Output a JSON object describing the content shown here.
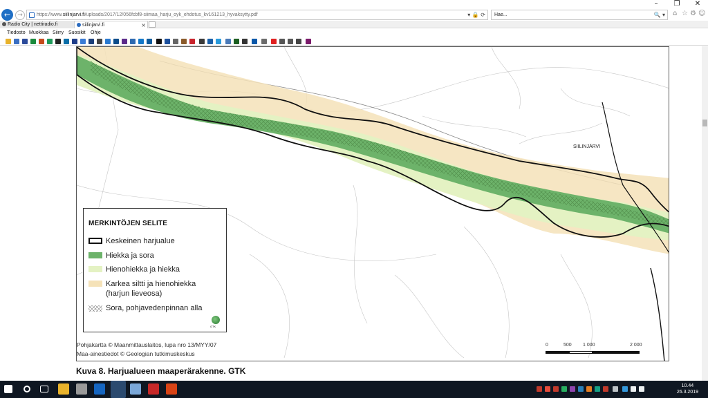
{
  "browser": {
    "window_controls": {
      "minimize": "–",
      "restore": "❐",
      "close": "✕"
    },
    "address": {
      "url_prefix": "https://www.",
      "url_domain": "siilinjarvi.fi",
      "url_path": "/uploads/2017/12/056fcbf8-siimaa_harju_oyk_ehdotus_kv161213_hyvaksytty.pdf",
      "tools": "▾ 🔒 ⟳",
      "search_placeholder": "Hae...",
      "search_tools": "🔍 ▾"
    },
    "tabs": [
      {
        "label": "Radio City | nettiradio.fi",
        "icon_color": "#555555"
      },
      {
        "label": "siilinjarvi.fi",
        "icon_color": "#2a6bbf",
        "close": "×"
      }
    ],
    "menu": [
      "Tiedosto",
      "Muokkaa",
      "Siirry",
      "Suosikit",
      "Ohje"
    ]
  },
  "document": {
    "legend": {
      "title": "MERKINTÖJEN SELITE",
      "items": [
        {
          "label": "Keskeinen harjualue",
          "swatch": "outline"
        },
        {
          "label": "Hiekka ja sora",
          "color": "#6db36a"
        },
        {
          "label": "Hienohiekka ja hiekka",
          "color": "#e4f2c3"
        },
        {
          "label": "Karkea siltti ja hienohiekka",
          "label2": "(harjun lieveosa)",
          "color": "#f5e2b8"
        },
        {
          "label": "Sora, pohjavedenpinnan alla",
          "swatch": "crosshatch"
        }
      ],
      "logo_text": "GTK"
    },
    "map_labels": {
      "town": "SIILINJÄRVI"
    },
    "credits": [
      "Pohjakartta ©  Maanmittauslaitos, lupa nro 13/MYY/07",
      "Maa-ainestiedot ©  Geologian tutkimuskeskus"
    ],
    "scale": {
      "ticks": [
        "0",
        "500",
        "1 000",
        "2 000"
      ]
    },
    "caption": "Kuva 8. Harjualueen maaperärakenne. GTK"
  },
  "taskbar": {
    "time": "10.44",
    "date": "26.3.2019"
  },
  "colors": {
    "accent": "#1f6fc5",
    "esker_core": "#6db36a",
    "fine_sand": "#e4f2c3",
    "silt": "#f5e2b8",
    "taskbar": "#0f1722"
  }
}
